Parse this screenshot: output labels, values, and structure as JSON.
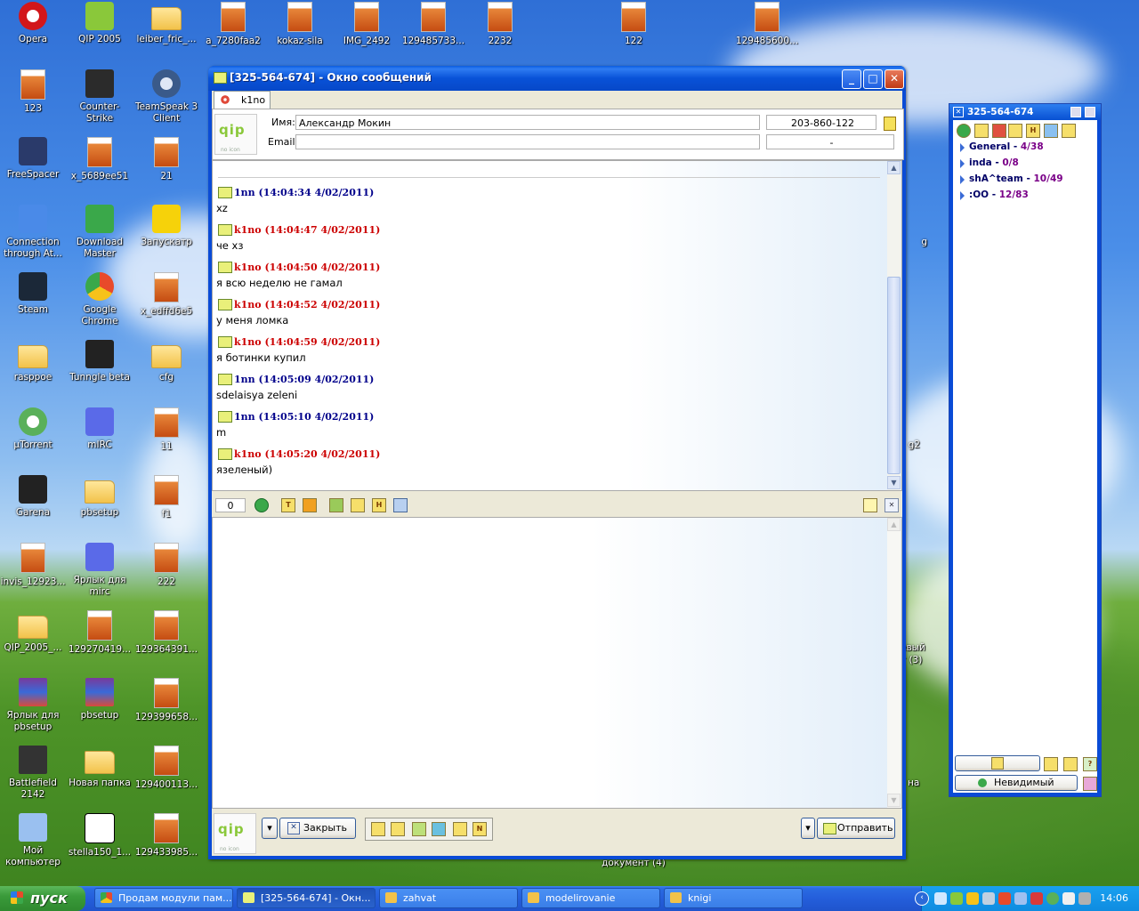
{
  "desktop": {
    "icons": [
      {
        "label": "Opera",
        "kind": "opera"
      },
      {
        "label": "QIP 2005",
        "kind": "qip"
      },
      {
        "label": "leiber_fric_...",
        "kind": "folder"
      },
      {
        "label": "a_7280faa2",
        "kind": "file"
      },
      {
        "label": "kokaz-sila",
        "kind": "file"
      },
      {
        "label": "IMG_2492",
        "kind": "file"
      },
      {
        "label": "129485733...",
        "kind": "file"
      },
      {
        "label": "2232",
        "kind": "file"
      },
      {
        "label": "122",
        "kind": "file"
      },
      {
        "label": "129485600...",
        "kind": "file"
      },
      {
        "label": "123",
        "kind": "file"
      },
      {
        "label": "Counter-Strike",
        "kind": "cs"
      },
      {
        "label": "TeamSpeak 3 Client",
        "kind": "ts"
      },
      {
        "label": "FreeSpacer",
        "kind": "fs"
      },
      {
        "label": "x_5689ee51",
        "kind": "file"
      },
      {
        "label": "21",
        "kind": "file"
      },
      {
        "label": "Connection through At...",
        "kind": "conn"
      },
      {
        "label": "Download Master",
        "kind": "dm"
      },
      {
        "label": "Запускатр",
        "kind": "zap"
      },
      {
        "label": "Steam",
        "kind": "steam"
      },
      {
        "label": "Google Chrome",
        "kind": "chrome"
      },
      {
        "label": "x_edffd6e5",
        "kind": "file"
      },
      {
        "label": "rasppoe",
        "kind": "folder"
      },
      {
        "label": "Tunngle beta",
        "kind": "tunngle"
      },
      {
        "label": "cfg",
        "kind": "folder"
      },
      {
        "label": "µTorrent",
        "kind": "utorrent"
      },
      {
        "label": "mIRC",
        "kind": "mirc"
      },
      {
        "label": "11",
        "kind": "file"
      },
      {
        "label": "Garena",
        "kind": "garena"
      },
      {
        "label": "pbsetup",
        "kind": "folder"
      },
      {
        "label": "f1",
        "kind": "file"
      },
      {
        "label": "invis_12923...",
        "kind": "file"
      },
      {
        "label": "Ярлык для mirc",
        "kind": "mirc"
      },
      {
        "label": "222",
        "kind": "file"
      },
      {
        "label": "QIP_2005_...",
        "kind": "folder"
      },
      {
        "label": "129270419...",
        "kind": "file"
      },
      {
        "label": "129364391...",
        "kind": "file"
      },
      {
        "label": "Ярлык для pbsetup",
        "kind": "rar"
      },
      {
        "label": "pbsetup",
        "kind": "rar"
      },
      {
        "label": "129399658...",
        "kind": "file"
      },
      {
        "label": "Battlefield 2142",
        "kind": "bf"
      },
      {
        "label": "Новая папка",
        "kind": "folder"
      },
      {
        "label": "129400113...",
        "kind": "file"
      },
      {
        "label": "Мой компьютер",
        "kind": "mycomp"
      },
      {
        "label": "stella150_1...",
        "kind": "7z"
      },
      {
        "label": "129433985...",
        "kind": "file"
      }
    ],
    "partial_labels": [
      "g",
      "g2",
      "евый",
      "т (3)",
      "на",
      "документ (4)"
    ]
  },
  "message_window": {
    "title": "[325-564-674] - Окно сообщений",
    "tab_label": "k1no",
    "name_label": "Имя:",
    "name_value": "Александр  Мокин",
    "uin_value": "203-860-122",
    "email_label": "Email:",
    "email_value": "",
    "email_extra": "-",
    "messages": [
      {
        "sender": "1nn",
        "time": "(14:04:34 4/02/2011)",
        "text": "xz",
        "side": "me"
      },
      {
        "sender": "k1no",
        "time": "(14:04:47 4/02/2011)",
        "text": "че хз",
        "side": "them"
      },
      {
        "sender": "k1no",
        "time": "(14:04:50 4/02/2011)",
        "text": "я всю неделю не гамал",
        "side": "them"
      },
      {
        "sender": "k1no",
        "time": "(14:04:52 4/02/2011)",
        "text": "у меня ломка",
        "side": "them"
      },
      {
        "sender": "k1no",
        "time": "(14:04:59 4/02/2011)",
        "text": "я ботинки купил",
        "side": "them"
      },
      {
        "sender": "1nn",
        "time": "(14:05:09 4/02/2011)",
        "text": "sdelaisya zeleni",
        "side": "me"
      },
      {
        "sender": "1nn",
        "time": "(14:05:10 4/02/2011)",
        "text": "m",
        "side": "me"
      },
      {
        "sender": "k1no",
        "time": "(14:05:20 4/02/2011)",
        "text": "язеленый)",
        "side": "them"
      }
    ],
    "char_count": "0",
    "close_button": "Закрыть",
    "send_button": "Отправить",
    "toolbar_letters": {
      "t": "T",
      "h": "H",
      "n": "N"
    },
    "logo_text": "qip",
    "logo_sub": "no icon"
  },
  "contact_list": {
    "title": "325-564-674",
    "groups": [
      {
        "name": "General",
        "sep": " - ",
        "count": "4/38"
      },
      {
        "name": "inda",
        "sep": " - ",
        "count": "0/8"
      },
      {
        "name": "shA^team",
        "sep": " - ",
        "count": "10/49"
      },
      {
        "name": ":OO",
        "sep": " - ",
        "count": "12/83"
      }
    ],
    "status_button": "Невидимый"
  },
  "taskbar": {
    "start_label": "пуск",
    "tasks": [
      {
        "label": "Продам модули пам...",
        "active": false
      },
      {
        "label": "[325-564-674] - Окн...",
        "active": true
      },
      {
        "label": "zahvat",
        "active": false
      },
      {
        "label": "modelirovanie",
        "active": false
      },
      {
        "label": "knigi",
        "active": false
      }
    ],
    "clock": "14:06"
  },
  "colors": {
    "me": "#00008b",
    "them": "#cc0000",
    "titlebar": "#0a4bd6",
    "contact_count": "#7a0088"
  }
}
